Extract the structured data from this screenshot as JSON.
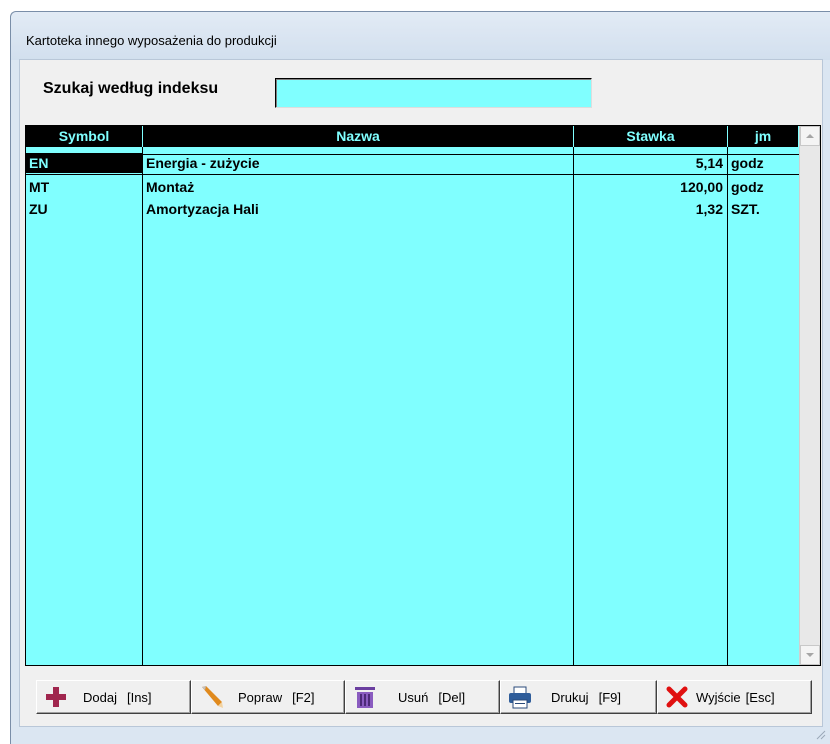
{
  "window": {
    "title": "Kartoteka  innego wyposażenia do produkcji"
  },
  "search": {
    "label": "Szukaj według indeksu",
    "value": ""
  },
  "table": {
    "columns": [
      "Symbol",
      "Nazwa",
      "Stawka",
      "jm"
    ],
    "rows": [
      {
        "symbol": "EN",
        "nazwa": "Energia - zużycie",
        "stawka": "5,14",
        "jm": "godz"
      },
      {
        "symbol": "MT",
        "nazwa": "Montaż",
        "stawka": "120,00",
        "jm": "godz"
      },
      {
        "symbol": "ZU",
        "nazwa": "Amortyzacja Hali",
        "stawka": "1,32",
        "jm": "SZT."
      }
    ],
    "selected_row": 0
  },
  "toolbar": {
    "add": {
      "label": "Dodaj",
      "key": "[Ins]",
      "icon": "plus-icon"
    },
    "edit": {
      "label": "Popraw",
      "key": "[F2]",
      "icon": "pencil-icon"
    },
    "delete": {
      "label": "Usuń",
      "key": "[Del]",
      "icon": "trash-icon"
    },
    "print": {
      "label": "Drukuj",
      "key": "[F9]",
      "icon": "printer-icon"
    },
    "exit": {
      "label": "Wyjście",
      "key": "[Esc]",
      "icon": "close-icon"
    }
  },
  "colors": {
    "grid_background": "#80ffff",
    "header_background": "#000000",
    "header_text": "#80ffff"
  }
}
